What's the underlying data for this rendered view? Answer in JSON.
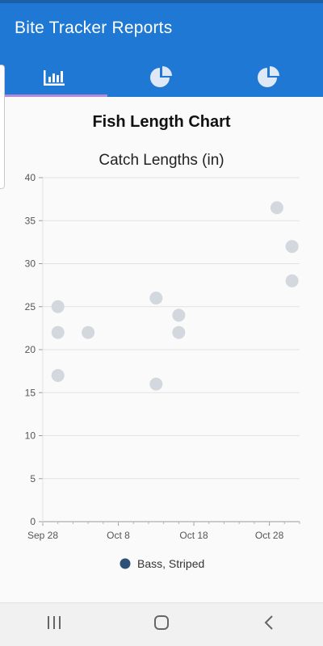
{
  "app": {
    "title": "Bite Tracker Reports"
  },
  "tabs": [
    {
      "icon": "bar-chart-icon",
      "selected": true
    },
    {
      "icon": "pie-chart-icon",
      "selected": false
    },
    {
      "icon": "pie-chart-icon",
      "selected": false
    }
  ],
  "colors": {
    "app_bar": "#1e78d4",
    "tab_indicator": "#b38bd9",
    "point": "#d3d7de",
    "legend_marker": "#2c5076"
  },
  "card": {
    "title": "Fish Length Chart"
  },
  "chart_data": {
    "type": "scatter",
    "title": "Catch Lengths (in)",
    "x_ticks": [
      "Sep 28",
      "Oct 8",
      "Oct 18",
      "Oct 28"
    ],
    "xlim": [
      "2020-09-28",
      "2020-11-01"
    ],
    "ylim": [
      0,
      40
    ],
    "y_ticks": [
      0,
      5,
      10,
      15,
      20,
      25,
      30,
      35,
      40
    ],
    "grid": true,
    "legend": "bottom",
    "series": [
      {
        "name": "Bass, Striped",
        "points": [
          {
            "x": "2020-09-30",
            "y": 25
          },
          {
            "x": "2020-09-30",
            "y": 22
          },
          {
            "x": "2020-09-30",
            "y": 17
          },
          {
            "x": "2020-10-04",
            "y": 22
          },
          {
            "x": "2020-10-13",
            "y": 26
          },
          {
            "x": "2020-10-13",
            "y": 16
          },
          {
            "x": "2020-10-16",
            "y": 24
          },
          {
            "x": "2020-10-16",
            "y": 22
          },
          {
            "x": "2020-10-29",
            "y": 36.5
          },
          {
            "x": "2020-10-31",
            "y": 32
          },
          {
            "x": "2020-10-31",
            "y": 28
          }
        ]
      }
    ]
  },
  "nav": [
    {
      "icon": "recent-apps-icon"
    },
    {
      "icon": "home-icon"
    },
    {
      "icon": "back-icon"
    }
  ]
}
